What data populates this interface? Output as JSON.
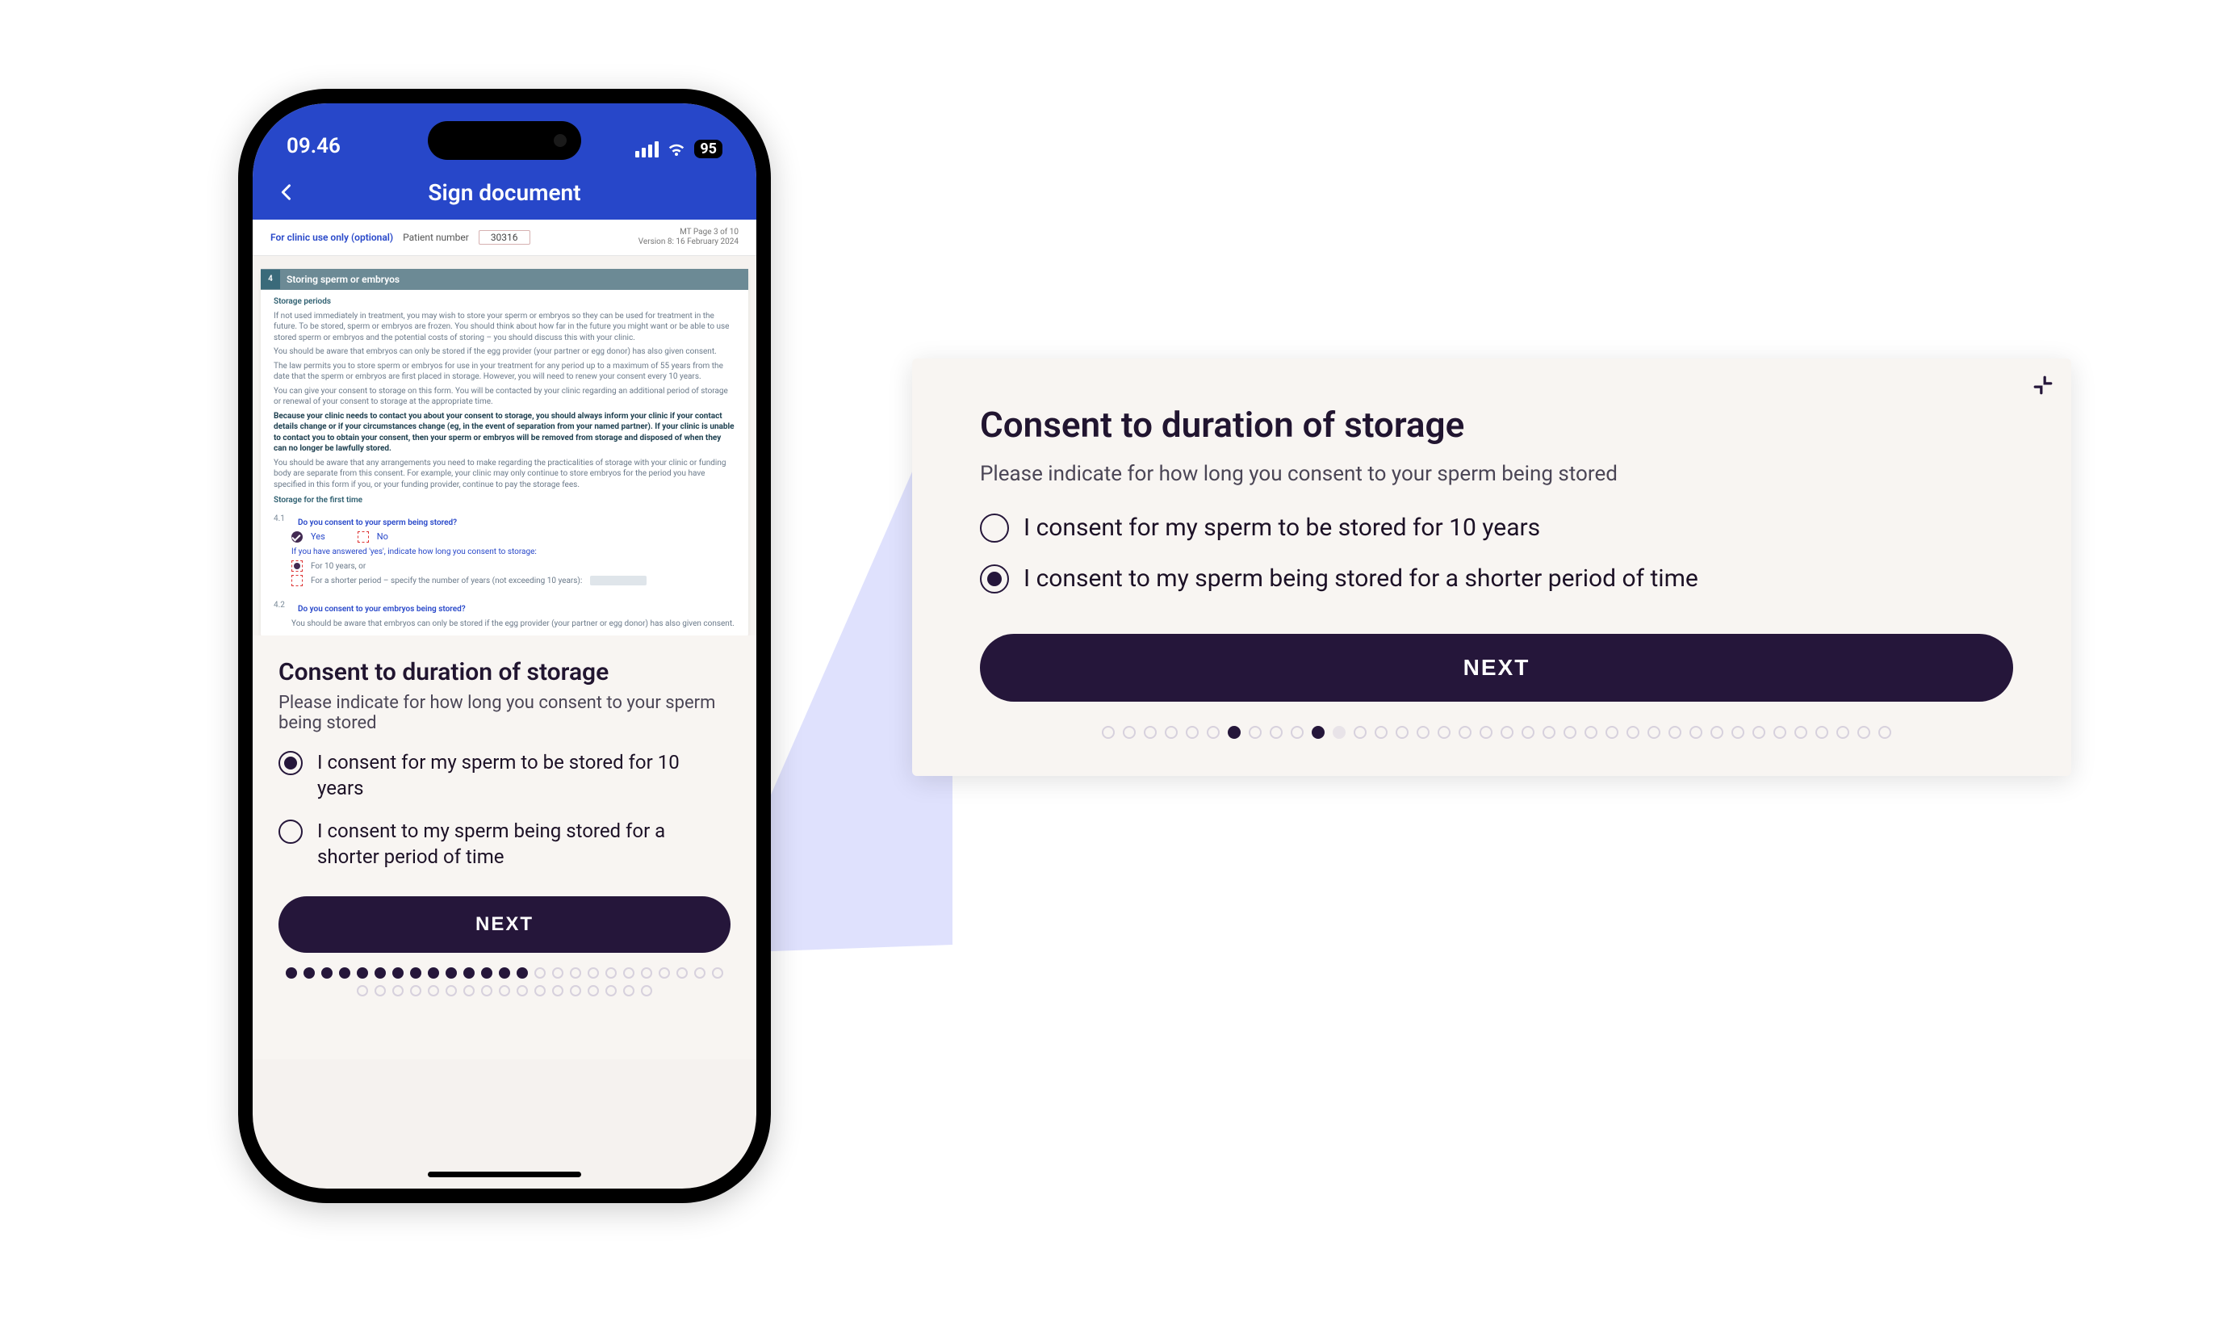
{
  "status": {
    "time": "09.46",
    "battery": "95"
  },
  "nav": {
    "title": "Sign document"
  },
  "meta": {
    "clinic_label": "For clinic use only (optional)",
    "patient_label": "Patient number",
    "patient_number": "30316",
    "page_info": "MT Page 3 of 10",
    "version_info": "Version 8: 16 February 2024"
  },
  "doc": {
    "section_number": "4",
    "section_title": "Storing sperm or embryos",
    "h_periods": "Storage periods",
    "p1": "If not used immediately in treatment, you may wish to store your sperm or embryos so they can be used for treatment in the future. To be stored, sperm or embryos are frozen. You should think about how far in the future you might want or be able to use stored sperm or embryos and the potential costs of storing – you should discuss this with your clinic.",
    "p2": "You should be aware that embryos can only be stored if the egg provider (your partner or egg donor) has also given consent.",
    "p3": "The law permits you to store sperm or embryos for use in your treatment for any period up to a maximum of 55 years from the date that the sperm or embryos are first placed in storage. However, you will need to renew your consent every 10 years.",
    "p4": "You can give your consent to storage on this form. You will be contacted by your clinic regarding an additional period of storage or renewal of your consent to storage at the appropriate time.",
    "p5_bold": "Because your clinic needs to contact you about your consent to storage, you should always inform your clinic if your contact details change or if your circumstances change (eg, in the event of separation from your named partner). If your clinic is unable to contact you to obtain your consent, then your sperm or embryos will be removed from storage and disposed of when they can no longer be lawfully stored.",
    "p6": "You should be aware that any arrangements you need to make regarding the practicalities of storage with your clinic or funding body are separate from this consent. For example, your clinic may only continue to store embryos for the period you have specified in this form if you, or your funding provider, continue to pay the storage fees.",
    "h_first": "Storage for the first time",
    "q41_idx": "4.1",
    "q41": "Do you consent to your sperm being stored?",
    "yes": "Yes",
    "no": "No",
    "q41_sub": "If you have answered 'yes', indicate how long you consent to storage:",
    "q41_opt1": "For 10 years, or",
    "q41_opt2": "For a shorter period – specify the number of years (not exceeding 10 years):",
    "q42_idx": "4.2",
    "q42": "Do you consent to your embryos being stored?",
    "q42_note": "You should be aware that embryos can only be stored if the egg provider (your partner or egg donor) has also given consent."
  },
  "card": {
    "title": "Consent to duration of storage",
    "subtitle": "Please indicate for how long you consent to your sperm being stored",
    "opt1": "I consent for my sperm to be stored for 10 years",
    "opt2": "I consent to my sperm being stored for a shorter period of time",
    "next": "NEXT",
    "phone_selected": 0,
    "zoom_selected": 1,
    "phone_pager": [
      1,
      1,
      1,
      1,
      1,
      1,
      1,
      1,
      1,
      1,
      1,
      1,
      1,
      1,
      0,
      0,
      0,
      0,
      0,
      0,
      0,
      0,
      0,
      0,
      0,
      0,
      0,
      0,
      0,
      0,
      0,
      0,
      0,
      0,
      0,
      0,
      0,
      0,
      0,
      0,
      0,
      0
    ],
    "zoom_pager": [
      0,
      0,
      0,
      0,
      0,
      0,
      1,
      0,
      0,
      0,
      1,
      2,
      0,
      0,
      0,
      0,
      0,
      0,
      0,
      0,
      0,
      0,
      0,
      0,
      0,
      0,
      0,
      0,
      0,
      0,
      0,
      0,
      0,
      0,
      0,
      0,
      0,
      0
    ]
  }
}
